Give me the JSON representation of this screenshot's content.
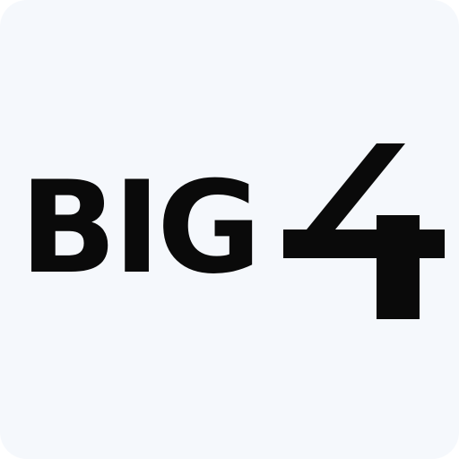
{
  "icon": {
    "background_color": "#f5f8fc",
    "ink_color": "#0a0a0a",
    "logo_word": "BIG",
    "logo_numeral": "4"
  }
}
